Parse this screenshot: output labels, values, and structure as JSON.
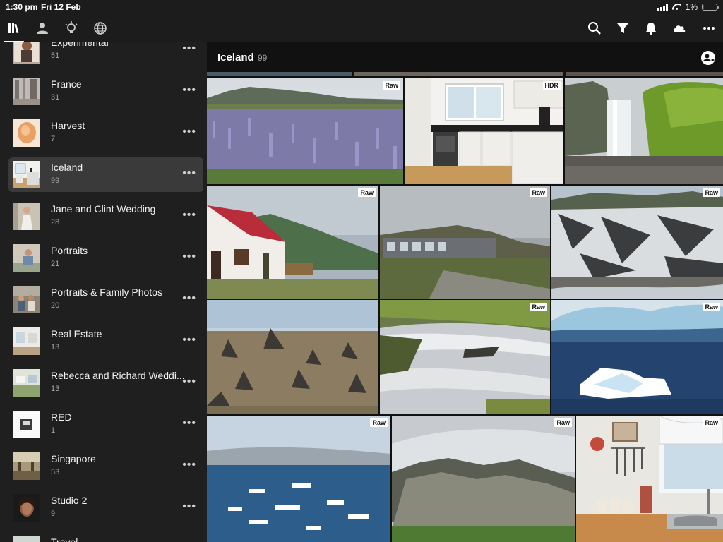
{
  "status_bar": {
    "time": "1:30 pm",
    "date": "Fri 12 Feb",
    "battery": "1%"
  },
  "toolbar": {
    "left_icons": [
      "library-icon",
      "people-icon",
      "learn-icon",
      "discover-icon"
    ],
    "right_icons": [
      "search-icon",
      "filter-icon",
      "notifications-icon",
      "cloud-icon",
      "more-icon"
    ]
  },
  "sidebar": {
    "albums": [
      {
        "name": "Experimental",
        "count": "51"
      },
      {
        "name": "France",
        "count": "31"
      },
      {
        "name": "Harvest",
        "count": "7"
      },
      {
        "name": "Iceland",
        "count": "99",
        "selected": true
      },
      {
        "name": "Jane and Clint Wedding",
        "count": "28"
      },
      {
        "name": "Portraits",
        "count": "21"
      },
      {
        "name": "Portraits & Family Photos",
        "count": "20"
      },
      {
        "name": "Real Estate",
        "count": "13"
      },
      {
        "name": "Rebecca and Richard Weddi...",
        "count": "13"
      },
      {
        "name": "RED",
        "count": "1"
      },
      {
        "name": "Singapore",
        "count": "53"
      },
      {
        "name": "Studio 2",
        "count": "9"
      },
      {
        "name": "Travel",
        "count": ""
      }
    ],
    "more_label": "•••"
  },
  "main": {
    "title": "Iceland",
    "count": "99",
    "photos": [
      {
        "scene": "lupine-field",
        "badge": "Raw"
      },
      {
        "scene": "kitchen",
        "badge": "HDR"
      },
      {
        "scene": "waterfall",
        "badge": ""
      },
      {
        "scene": "red-roof-house",
        "badge": "Raw"
      },
      {
        "scene": "guesthouse",
        "badge": "Raw"
      },
      {
        "scene": "glacier",
        "badge": "Raw"
      },
      {
        "scene": "lava-field",
        "badge": ""
      },
      {
        "scene": "rapids",
        "badge": "Raw"
      },
      {
        "scene": "iceberg",
        "badge": "Raw"
      },
      {
        "scene": "ice-lagoon",
        "badge": "Raw"
      },
      {
        "scene": "misty-mountain",
        "badge": "Raw"
      },
      {
        "scene": "kitchen-window",
        "badge": "Raw"
      }
    ]
  },
  "colors": {
    "background": "#1c1c1c",
    "selected": "#3a3a3a",
    "header": "#111111"
  }
}
